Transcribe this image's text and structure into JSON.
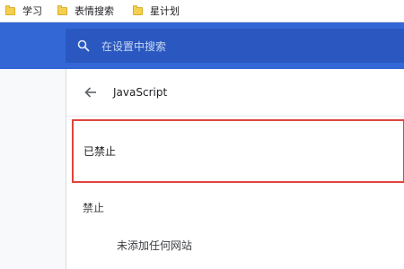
{
  "bookmarks": [
    {
      "label": "学习",
      "icon": "folder-icon"
    },
    {
      "label": "表情搜索",
      "icon": "folder-icon"
    },
    {
      "label": "星计划",
      "icon": "folder-icon"
    }
  ],
  "header": {
    "search_placeholder": "在设置中搜索",
    "search_icon": "search-icon"
  },
  "page": {
    "back_icon": "back-arrow-icon",
    "title": "JavaScript",
    "blocked_setting": "已禁止",
    "blocked_section_label": "禁止",
    "empty_message": "未添加任何网站"
  },
  "colors": {
    "header_bg": "#3367d6",
    "search_bg": "#2a58c0",
    "highlight_border": "#e0443e"
  }
}
